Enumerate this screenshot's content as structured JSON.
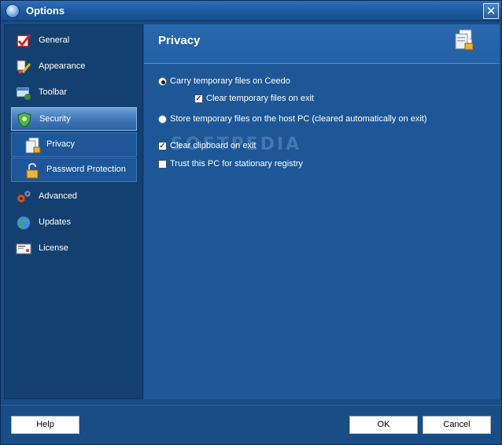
{
  "window": {
    "title": "Options"
  },
  "sidebar": {
    "items": [
      {
        "label": "General",
        "icon": "general-checkmark-icon"
      },
      {
        "label": "Appearance",
        "icon": "appearance-brush-icon"
      },
      {
        "label": "Toolbar",
        "icon": "toolbar-screen-icon"
      },
      {
        "label": "Security",
        "icon": "security-shield-icon",
        "selected": true
      },
      {
        "label": "Advanced",
        "icon": "advanced-gears-icon"
      },
      {
        "label": "Updates",
        "icon": "updates-globe-icon"
      },
      {
        "label": "License",
        "icon": "license-certificate-icon"
      }
    ],
    "sub_items": [
      {
        "label": "Privacy",
        "icon": "privacy-documents-icon",
        "selected": true
      },
      {
        "label": "Password Protection",
        "icon": "padlock-icon"
      }
    ]
  },
  "main": {
    "title": "Privacy",
    "options": {
      "carry_temp": {
        "label": "Carry temporary files on Ceedo",
        "checked": true
      },
      "clear_temp": {
        "label": "Clear temporary files on exit",
        "checked": true
      },
      "store_host": {
        "label": "Store temporary files on the host PC (cleared automatically on exit)",
        "checked": false
      },
      "clear_clipboard": {
        "label": "Clear clipboard on exit",
        "checked": true
      },
      "trust_pc": {
        "label": "Trust this PC for stationary registry",
        "checked": false
      }
    },
    "watermark": "SOFTPEDIA"
  },
  "footer": {
    "help_label": "Help",
    "ok_label": "OK",
    "cancel_label": "Cancel"
  }
}
